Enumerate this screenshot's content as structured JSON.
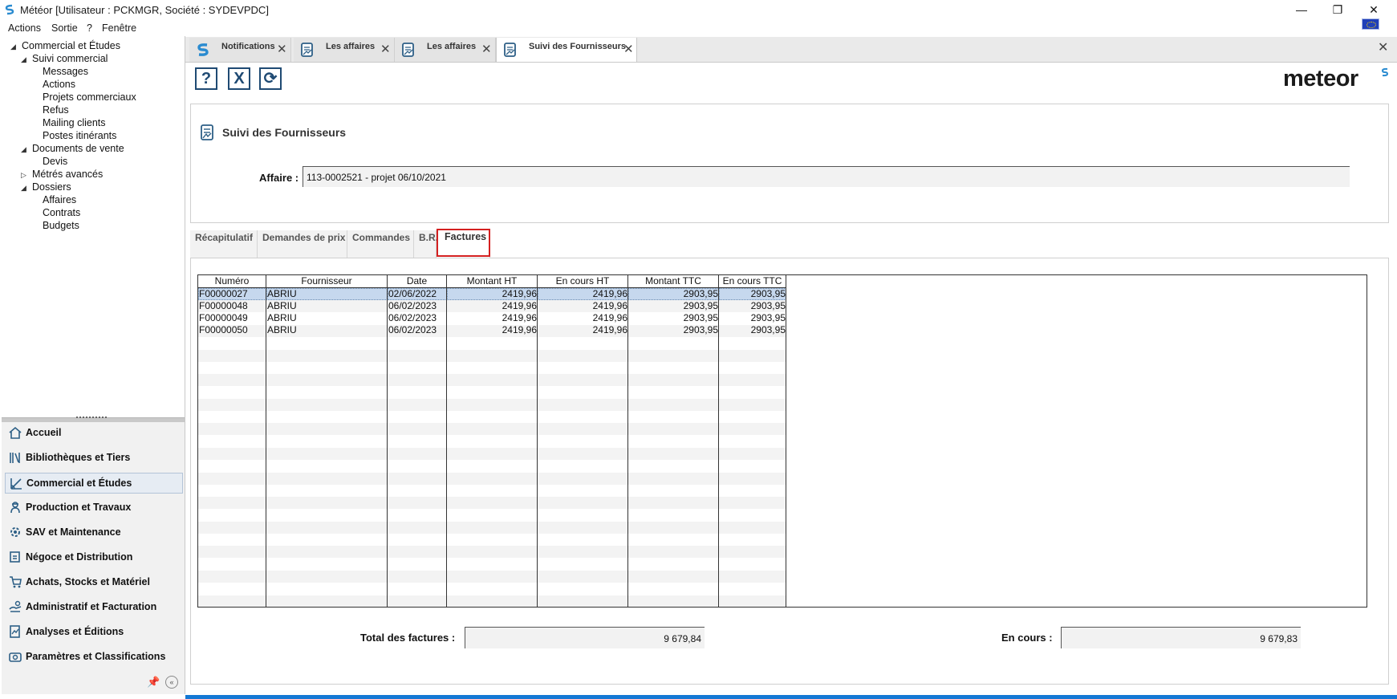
{
  "window": {
    "title": "Météor [Utilisateur : PCKMGR, Société : SYDEVPDC]",
    "minimize": "—",
    "restore": "❐",
    "close": "✕"
  },
  "menu": [
    "Actions",
    "Sortie",
    "?",
    "Fenêtre"
  ],
  "tree": [
    {
      "label": "Commercial et Études",
      "level": 0,
      "arrow": "◢"
    },
    {
      "label": "Suivi commercial",
      "level": 1,
      "arrow": "◢"
    },
    {
      "label": "Messages",
      "level": 2
    },
    {
      "label": "Actions",
      "level": 2
    },
    {
      "label": "Projets commerciaux",
      "level": 2
    },
    {
      "label": "Refus",
      "level": 2
    },
    {
      "label": "Mailing clients",
      "level": 2
    },
    {
      "label": "Postes itinérants",
      "level": 2
    },
    {
      "label": "Documents de vente",
      "level": 1,
      "arrow": "◢"
    },
    {
      "label": "Devis",
      "level": 2
    },
    {
      "label": "Métrés avancés",
      "level": 1,
      "arrow": "▷"
    },
    {
      "label": "Dossiers",
      "level": 1,
      "arrow": "◢"
    },
    {
      "label": "Affaires",
      "level": 2
    },
    {
      "label": "Contrats",
      "level": 2
    },
    {
      "label": "Budgets",
      "level": 2
    }
  ],
  "nav": [
    {
      "label": "Accueil",
      "icon": "home-icon"
    },
    {
      "label": "Bibliothèques et Tiers",
      "icon": "books-icon"
    },
    {
      "label": "Commercial et Études",
      "icon": "drafting-icon",
      "selected": true
    },
    {
      "label": "Production et Travaux",
      "icon": "worker-icon"
    },
    {
      "label": "SAV et Maintenance",
      "icon": "maintenance-icon"
    },
    {
      "label": "Négoce et Distribution",
      "icon": "trade-icon"
    },
    {
      "label": "Achats, Stocks et Matériel",
      "icon": "cart-icon"
    },
    {
      "label": "Administratif et Facturation",
      "icon": "billing-icon"
    },
    {
      "label": "Analyses et Éditions",
      "icon": "report-icon"
    },
    {
      "label": "Paramètres et Classifications",
      "icon": "settings-icon"
    }
  ],
  "tabs": [
    {
      "label": "Notifications",
      "icon": "notifications-icon"
    },
    {
      "label": "Les affaires",
      "icon": "document-icon"
    },
    {
      "label": "Les affaires",
      "icon": "document-icon"
    },
    {
      "label": "Suivi des Fournisseurs",
      "icon": "document-icon",
      "active": true
    }
  ],
  "toolbar": {
    "help": "?",
    "cancel": "X",
    "refresh": "⟳"
  },
  "logo": "meteor",
  "form": {
    "title": "Suivi des Fournisseurs",
    "affaire_label": "Affaire :",
    "affaire_value": "113-0002521 - projet 06/10/2021"
  },
  "subtabs": [
    "Récapitulatif",
    "Demandes de prix",
    "Commandes",
    "B.R.",
    "Factures"
  ],
  "active_subtab": "Factures",
  "grid": {
    "columns": [
      "Numéro",
      "Fournisseur",
      "Date",
      "Montant HT",
      "En cours HT",
      "Montant TTC",
      "En cours TTC"
    ],
    "rows": [
      [
        "F00000027",
        "ABRIU",
        "02/06/2022",
        "2419,96",
        "2419,96",
        "2903,95",
        "2903,95"
      ],
      [
        "F00000048",
        "ABRIU",
        "06/02/2023",
        "2419,96",
        "2419,96",
        "2903,95",
        "2903,95"
      ],
      [
        "F00000049",
        "ABRIU",
        "06/02/2023",
        "2419,96",
        "2419,96",
        "2903,95",
        "2903,95"
      ],
      [
        "F00000050",
        "ABRIU",
        "06/02/2023",
        "2419,96",
        "2419,96",
        "2903,95",
        "2903,95"
      ]
    ],
    "selected_row": 0
  },
  "totals": {
    "total_label": "Total des factures :",
    "total_value": "9 679,84",
    "encours_label": "En cours :",
    "encours_value": "9 679,83"
  },
  "colors": {
    "accent": "#1f4a73",
    "highlight": "#d42020",
    "selection": "#c6d8ee",
    "statusbar": "#1478d4"
  }
}
